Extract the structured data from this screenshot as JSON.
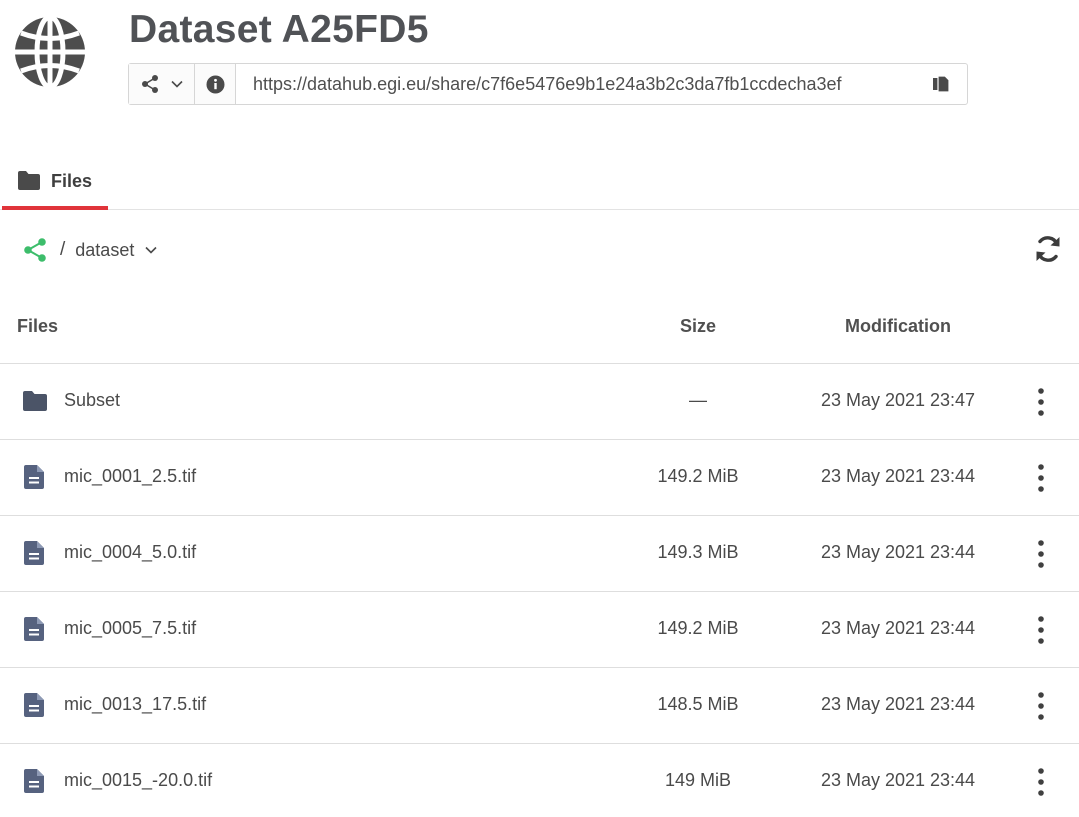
{
  "header": {
    "title": "Dataset A25FD5",
    "url": "https://datahub.egi.eu/share/c7f6e5476e9b1e24a3b2c3da7fb1ccdecha3ef",
    "icons": {
      "logo": "globe-icon",
      "share": "share-icon",
      "dropdown": "chevron-down-icon",
      "info": "info-icon",
      "copy": "copy-icon"
    }
  },
  "tabs": [
    {
      "label": "Files",
      "icon": "folder-icon",
      "active": true
    }
  ],
  "breadcrumb": {
    "separator": "/",
    "label": "dataset",
    "icons": {
      "share": "share-icon",
      "dropdown": "chevron-down-icon",
      "refresh": "refresh-icon"
    }
  },
  "table": {
    "columns": {
      "files": "Files",
      "size": "Size",
      "modification": "Modification"
    },
    "rows": [
      {
        "type": "folder",
        "name": "Subset",
        "size": "—",
        "modified": "23 May 2021 23:47"
      },
      {
        "type": "file",
        "name": "mic_0001_2.5.tif",
        "size": "149.2 MiB",
        "modified": "23 May 2021 23:44"
      },
      {
        "type": "file",
        "name": "mic_0004_5.0.tif",
        "size": "149.3 MiB",
        "modified": "23 May 2021 23:44"
      },
      {
        "type": "file",
        "name": "mic_0005_7.5.tif",
        "size": "149.2 MiB",
        "modified": "23 May 2021 23:44"
      },
      {
        "type": "file",
        "name": "mic_0013_17.5.tif",
        "size": "148.5 MiB",
        "modified": "23 May 2021 23:44"
      },
      {
        "type": "file",
        "name": "mic_0015_-20.0.tif",
        "size": "149 MiB",
        "modified": "23 May 2021 23:44"
      }
    ]
  },
  "colors": {
    "accent": "#e0343a",
    "share_green": "#3dbd6b",
    "folder": "#4b5467",
    "file": "#56627f",
    "title": "#505256"
  }
}
